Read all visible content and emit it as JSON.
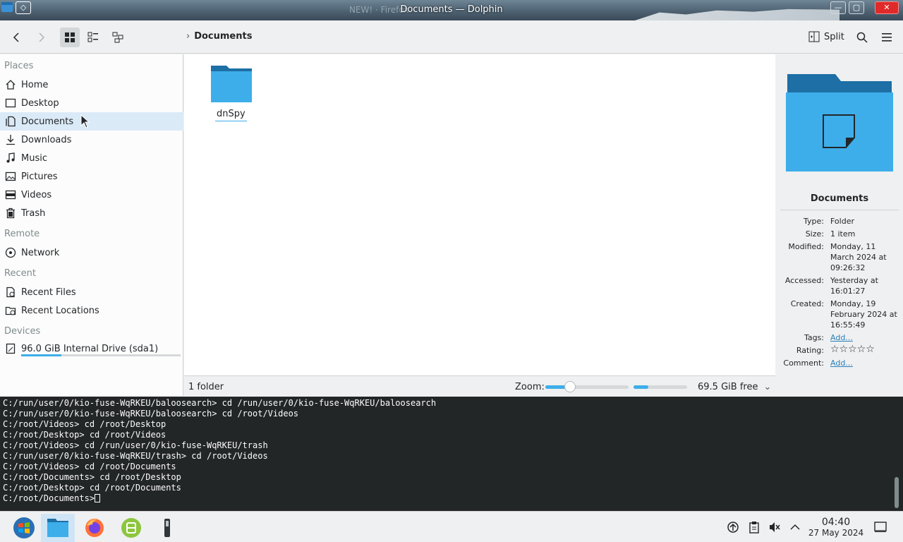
{
  "window": {
    "title": "Documents — Dolphin",
    "background_text": "NEW! · Firefox",
    "controls": [
      "minimize",
      "maximize",
      "close"
    ]
  },
  "toolbar": {
    "breadcrumb": "Documents",
    "split_label": "Split",
    "icons": [
      "back-icon",
      "forward-icon",
      "icons-view-icon",
      "details-view-icon",
      "tree-view-icon",
      "split-icon",
      "search-icon",
      "menu-icon"
    ]
  },
  "sidebar": {
    "places_header": "Places",
    "places": [
      "Home",
      "Desktop",
      "Documents",
      "Downloads",
      "Music",
      "Pictures",
      "Videos",
      "Trash"
    ],
    "selected": "Documents",
    "remote_header": "Remote",
    "remote": [
      "Network"
    ],
    "recent_header": "Recent",
    "recent": [
      "Recent Files",
      "Recent Locations"
    ],
    "devices_header": "Devices",
    "devices": [
      {
        "label": "96.0 GiB Internal Drive (sda1)",
        "used_fraction": 0.25
      }
    ]
  },
  "view": {
    "items": [
      {
        "name": "dnSpy",
        "type": "folder"
      }
    ]
  },
  "statusbar": {
    "summary": "1 folder",
    "zoom_label": "Zoom:",
    "zoom_fraction": 0.3,
    "free_space": "69.5 GiB free",
    "free_used_fraction": 0.27
  },
  "info_panel": {
    "title": "Documents",
    "type_label": "Type:",
    "type": "Folder",
    "size_label": "Size:",
    "size": "1 item",
    "modified_label": "Modified:",
    "modified": "Monday, 11 March 2024 at 09:26:32",
    "accessed_label": "Accessed:",
    "accessed": "Yesterday at 16:01:27",
    "created_label": "Created:",
    "created": "Monday, 19 February 2024 at 16:55:49",
    "tags_label": "Tags:",
    "tags": "Add...",
    "rating_label": "Rating:",
    "rating": "☆☆☆☆☆",
    "comment_label": "Comment:",
    "comment": "Add..."
  },
  "terminal": {
    "lines": [
      "C:/run/user/0/kio-fuse-WqRKEU/baloosearch> cd /run/user/0/kio-fuse-WqRKEU/baloosearch",
      "C:/run/user/0/kio-fuse-WqRKEU/baloosearch> cd /root/Videos",
      "C:/root/Videos> cd /root/Desktop",
      "C:/root/Desktop> cd /root/Videos",
      "C:/root/Videos> cd /run/user/0/kio-fuse-WqRKEU/trash",
      "C:/run/user/0/kio-fuse-WqRKEU/trash> cd /root/Videos",
      "C:/root/Videos> cd /root/Documents",
      "C:/root/Documents> cd /root/Desktop",
      "C:/root/Desktop> cd /root/Documents"
    ],
    "prompt": "C:/root/Documents>"
  },
  "taskbar": {
    "apps": [
      "start-menu-icon",
      "dolphin-icon",
      "firefox-icon",
      "app-icon",
      "terminal-icon"
    ],
    "tray": [
      "network-icon",
      "clipboard-icon",
      "volume-muted-icon",
      "expand-tray-icon"
    ],
    "time": "04:40",
    "date": "27 May 2024"
  }
}
